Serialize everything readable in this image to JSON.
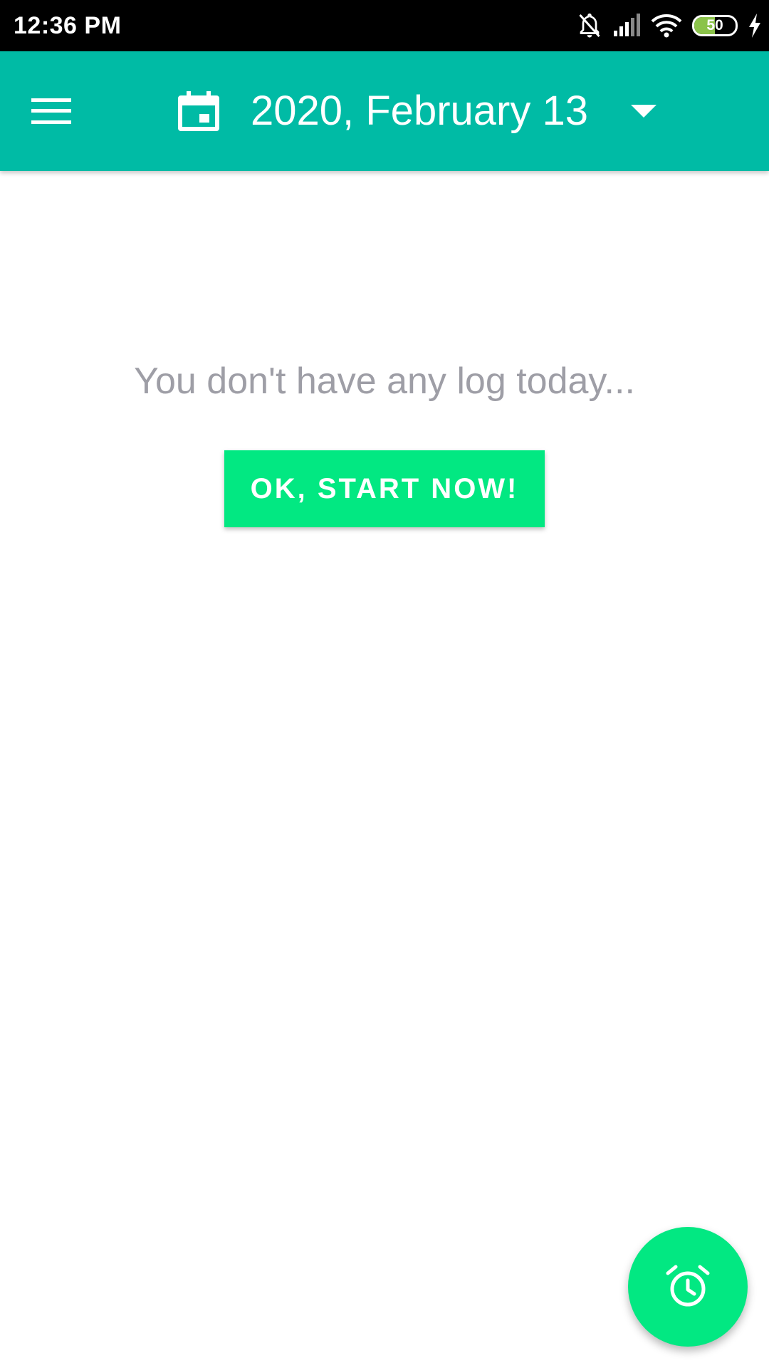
{
  "status_bar": {
    "time": "12:36 PM",
    "battery_level": "50",
    "battery_fraction": 0.5,
    "icons": [
      "notifications-off-icon",
      "cellular-signal-icon",
      "wifi-icon",
      "battery-icon",
      "charging-bolt-icon"
    ]
  },
  "app_bar": {
    "menu_icon": "hamburger-menu-icon",
    "calendar_icon": "calendar-icon",
    "date_label": "2020, February 13",
    "dropdown_icon": "dropdown-arrow-icon",
    "color": "#00bba5"
  },
  "main": {
    "empty_message": "You don't have any log today...",
    "start_button_label": "OK, START NOW!",
    "accent_color": "#02e882"
  },
  "fab": {
    "icon": "alarm-clock-icon"
  }
}
